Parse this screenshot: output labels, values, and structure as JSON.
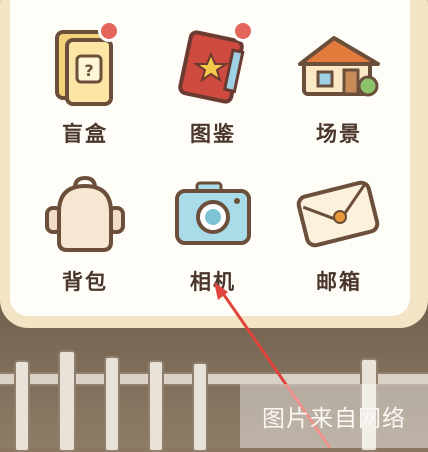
{
  "menu": {
    "items": [
      {
        "label": "盲盒",
        "icon": "blind-box-icon",
        "badge": true
      },
      {
        "label": "图鉴",
        "icon": "album-book-icon",
        "badge": true
      },
      {
        "label": "场景",
        "icon": "house-scene-icon",
        "badge": false
      },
      {
        "label": "背包",
        "icon": "backpack-icon",
        "badge": false
      },
      {
        "label": "相机",
        "icon": "camera-icon",
        "badge": false
      },
      {
        "label": "邮箱",
        "icon": "mail-envelope-icon",
        "badge": false
      }
    ]
  },
  "watermark": {
    "text": "图片来自网络"
  },
  "colors": {
    "panel_frame": "#f2e4c5",
    "panel_bg": "#fffdf8",
    "label": "#4a362b",
    "badge": "#e46559",
    "arrow": "#e0443a"
  }
}
